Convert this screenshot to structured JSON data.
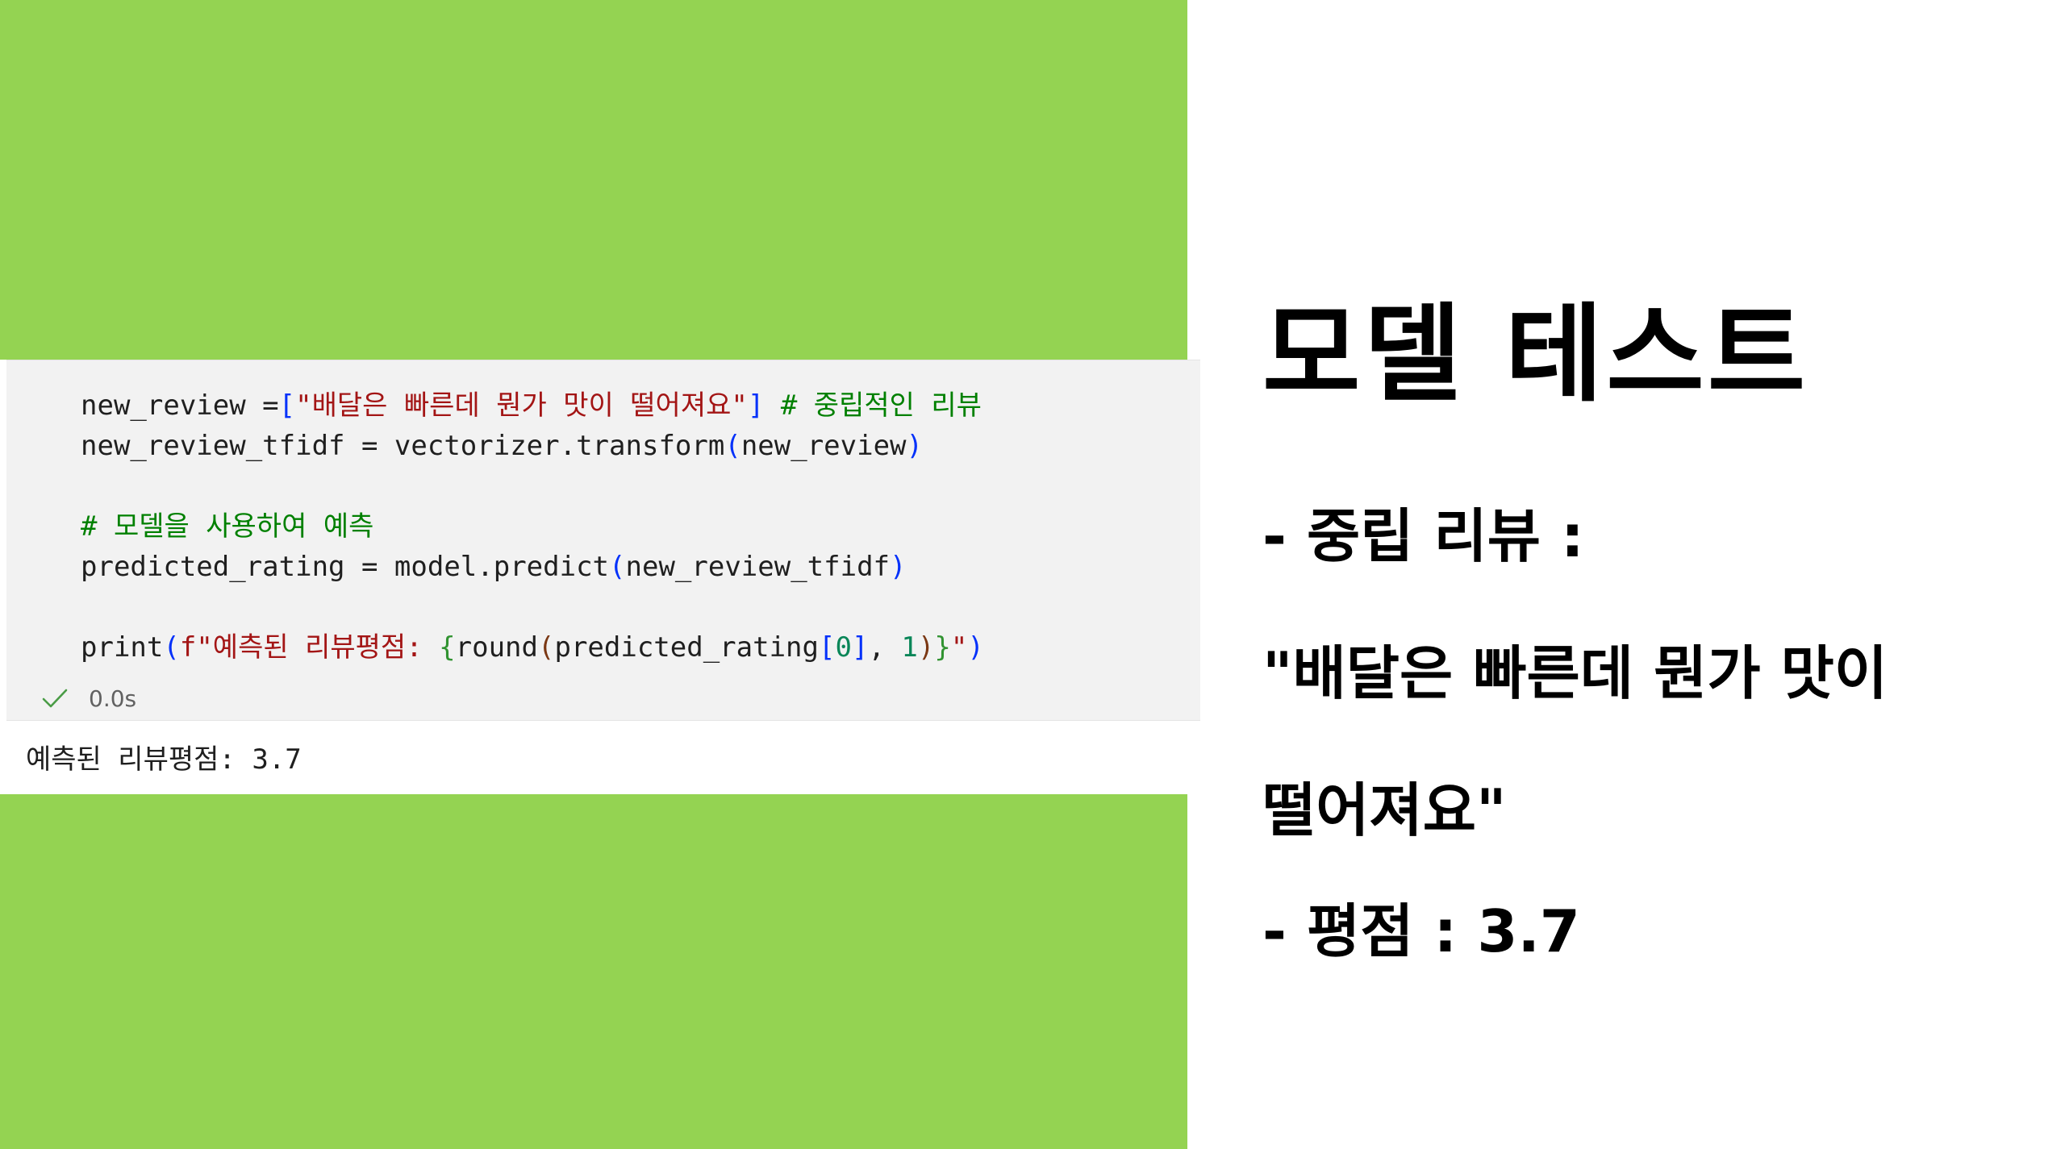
{
  "code_cell": {
    "lines": {
      "l1": {
        "a": "new_review =",
        "b": "[",
        "c": "\"배달은 빠른데 뭔가 맛이 떨어져요\"",
        "d": "]",
        "e": " ",
        "f": "# 중립적인 리뷰"
      },
      "l2": {
        "a": "new_review_tfidf = vectorizer.transform",
        "b": "(",
        "c": "new_review",
        "d": ")"
      },
      "l3": {
        "comment": "# 모델을 사용하여 예측"
      },
      "l4": {
        "a": "predicted_rating = model.predict",
        "b": "(",
        "c": "new_review_tfidf",
        "d": ")"
      },
      "l5": {
        "a": "print",
        "b": "(",
        "c": "f\"예측된 리뷰평점: ",
        "d": "{",
        "e": "round",
        "f": "(",
        "g": "predicted_rating",
        "h": "[",
        "i": "0",
        "j": "]",
        "k": ", ",
        "l": "1",
        "m": ")",
        "n": "}",
        "o": "\"",
        "p": ")"
      }
    },
    "status": {
      "icon": "check-icon",
      "duration": "0.0s"
    },
    "output": "예측된 리뷰평점: 3.7"
  },
  "slide": {
    "title": "모델 테스트",
    "neutral_label": "- 중립 리뷰 :",
    "review_line1": "\"배달은 빠른데 뭔가 맛이",
    "review_line2": "떨어져요\"",
    "rating_line": "- 평점 : 3.7"
  },
  "colors": {
    "accent_green": "#94d352",
    "string": "#a31515",
    "comment": "#008000",
    "bracket_blue": "#0431fa",
    "bracket_green": "#319331",
    "number": "#098658"
  }
}
